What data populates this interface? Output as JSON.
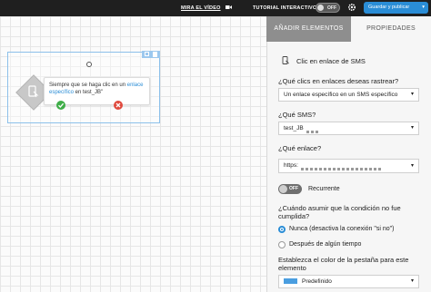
{
  "topbar": {
    "video_label": "MIRA EL VÍDEO",
    "tutorial_label": "TUTORIAL INTERACTIVO",
    "tutorial_toggle": "OFF",
    "publish_label": "Guardar y publicar",
    "publish_caret": "▾",
    "camera_icon": "camera-icon",
    "gear_icon": "gear-icon"
  },
  "canvas": {
    "node": {
      "text_before": "Siempre que se haga clic en un ",
      "text_link": "enlace específico",
      "text_after": " en test_JB\""
    }
  },
  "panel": {
    "tabs": {
      "add": "AÑADIR ELEMENTOS",
      "properties": "PROPIEDADES"
    },
    "section_title": "Clic en enlace de SMS",
    "q_track": "¿Qué clics en enlaces deseas rastrear?",
    "track_value": "Un enlace específico en un SMS específico",
    "q_sms": "¿Qué SMS?",
    "sms_value": "test_JB",
    "q_link": "¿Qué enlace?",
    "link_value": "https:",
    "recurrent_toggle": "OFF",
    "recurrent_label": "Recurrente",
    "q_condition": "¿Cuándo asumir que la condición no fue cumplida?",
    "option_never": "Nunca (desactiva la conexión \"si no\")",
    "option_after": "Después de algún tiempo",
    "q_color": "Establezca el color de la pestaña para este elemento",
    "color_value": "Predefinido",
    "caret": "▾",
    "accent_color": "#2a8dd6"
  }
}
